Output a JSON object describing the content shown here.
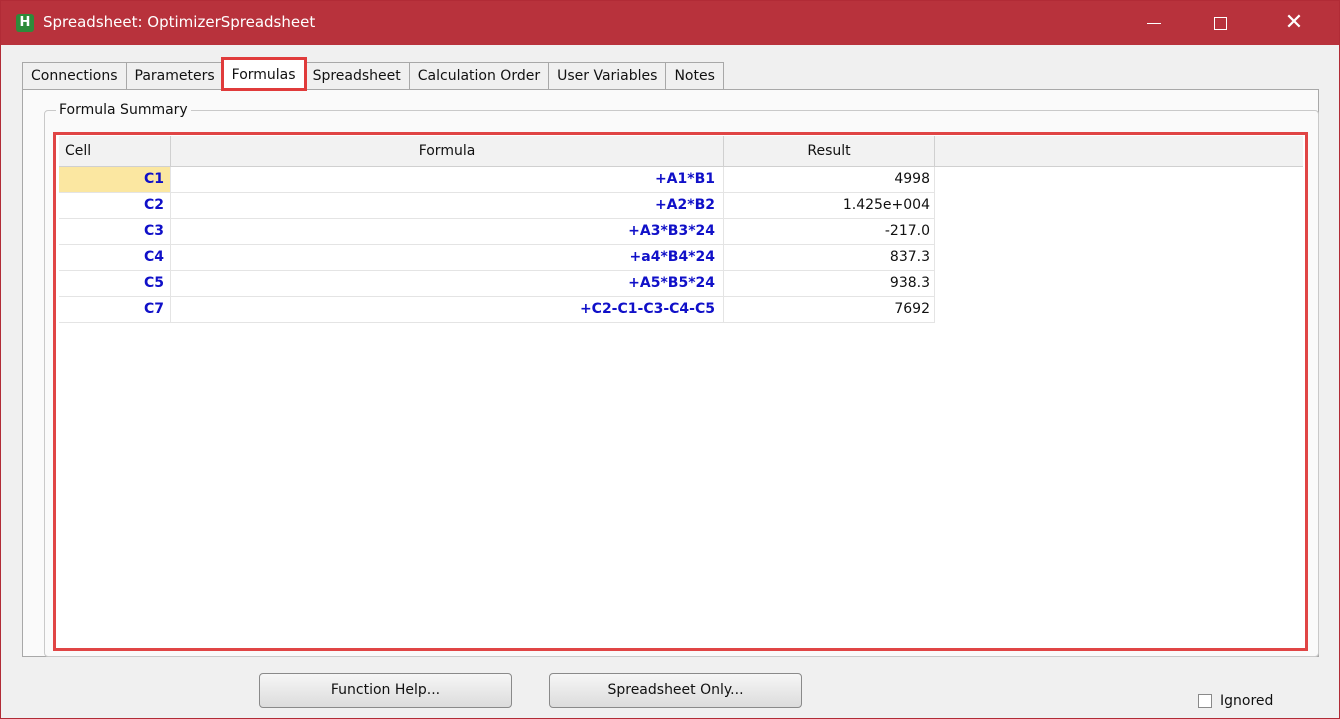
{
  "window": {
    "title": "Spreadsheet: OptimizerSpreadsheet",
    "icon_letter": "H"
  },
  "tabs": [
    {
      "label": "Connections"
    },
    {
      "label": "Parameters"
    },
    {
      "label": "Formulas",
      "active": true
    },
    {
      "label": "Spreadsheet"
    },
    {
      "label": "Calculation Order"
    },
    {
      "label": "User Variables"
    },
    {
      "label": "Notes"
    }
  ],
  "group": {
    "title": "Formula Summary"
  },
  "table": {
    "headers": {
      "cell": "Cell",
      "formula": "Formula",
      "result": "Result"
    },
    "rows": [
      {
        "cell": "C1",
        "formula": "+A1*B1",
        "result": "4998"
      },
      {
        "cell": "C2",
        "formula": "+A2*B2",
        "result": "1.425e+004"
      },
      {
        "cell": "C3",
        "formula": "+A3*B3*24",
        "result": "-217.0"
      },
      {
        "cell": "C4",
        "formula": "+a4*B4*24",
        "result": "837.3"
      },
      {
        "cell": "C5",
        "formula": "+A5*B5*24",
        "result": "938.3"
      },
      {
        "cell": "C7",
        "formula": "+C2-C1-C3-C4-C5",
        "result": "7692"
      }
    ]
  },
  "buttons": {
    "function_help": "Function Help...",
    "spreadsheet_only": "Spreadsheet Only..."
  },
  "ignored": {
    "label": "Ignored",
    "checked": false
  },
  "colors": {
    "titlebar": "#b8323c",
    "highlight": "#e03b3b",
    "cell_text": "#1010c8",
    "selected_cell": "#fbe7a1"
  }
}
